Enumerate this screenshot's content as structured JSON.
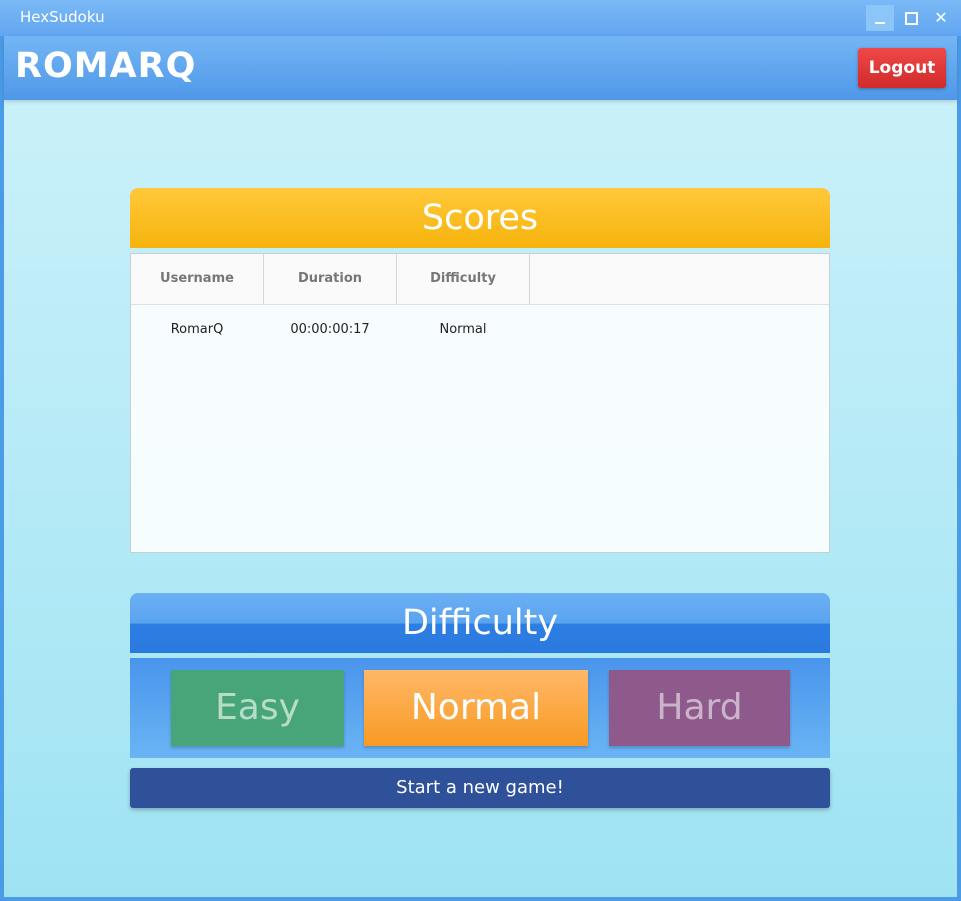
{
  "window": {
    "title": "HexSudoku",
    "controls": {
      "minimize": "_",
      "maximize": "□",
      "close": "✕"
    }
  },
  "header": {
    "username": "ROMARQ",
    "logout_label": "Logout"
  },
  "scores": {
    "title": "Scores",
    "columns": [
      "Username",
      "Duration",
      "Difficulty"
    ],
    "rows": [
      {
        "username": "RomarQ",
        "duration": "00:00:00:17",
        "difficulty": "Normal"
      }
    ]
  },
  "difficulty": {
    "title": "Difficulty",
    "options": [
      "Easy",
      "Normal",
      "Hard"
    ],
    "selected": "Normal"
  },
  "start_label": "Start a new game!",
  "colors": {
    "scores_banner": "#f6b30c",
    "difficulty_banner": "#2a79e0",
    "easy": "#48a57a",
    "normal": "#f89a23",
    "hard": "#8e5a8c",
    "start": "#2e519a",
    "logout": "#d02a2a"
  }
}
